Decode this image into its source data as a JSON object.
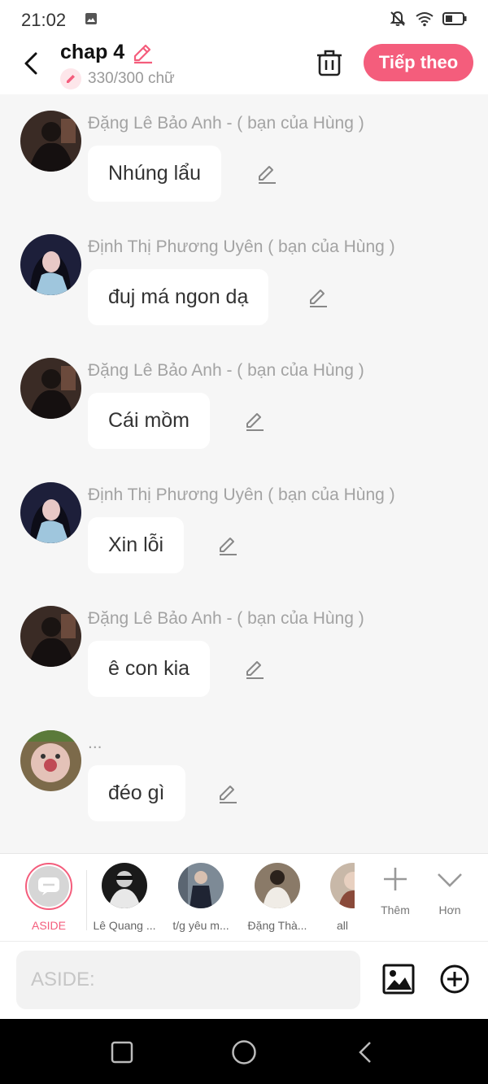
{
  "status": {
    "time": "21:02"
  },
  "header": {
    "title": "chap 4",
    "char_count": "330/300 chữ",
    "next_label": "Tiếp theo"
  },
  "messages": [
    {
      "sender": "Đặng Lê Bảo Anh - ( bạn của Hùng )",
      "text": "Nhúng lẩu"
    },
    {
      "sender": "Định Thị Phương Uyên ( bạn của Hùng )",
      "text": "đuj má ngon dạ"
    },
    {
      "sender": "Đặng Lê Bảo Anh - ( bạn của Hùng )",
      "text": "Cái mồm"
    },
    {
      "sender": "Định Thị Phương Uyên ( bạn của Hùng )",
      "text": "Xin lỗi"
    },
    {
      "sender": "Đặng Lê Bảo Anh - ( bạn của Hùng )",
      "text": "ê con kia"
    },
    {
      "sender": "...",
      "text": "đéo gì"
    }
  ],
  "characters": [
    {
      "name": "ASIDE"
    },
    {
      "name": "Lê Quang ..."
    },
    {
      "name": "t/g yêu m..."
    },
    {
      "name": "Đặng Thà..."
    },
    {
      "name": "all"
    }
  ],
  "tools": {
    "more_label": "Thêm",
    "expand_label": "Hơn"
  },
  "composer": {
    "placeholder": "ASIDE:"
  },
  "colors": {
    "accent": "#f45d7c",
    "background": "#f6f6f6"
  }
}
